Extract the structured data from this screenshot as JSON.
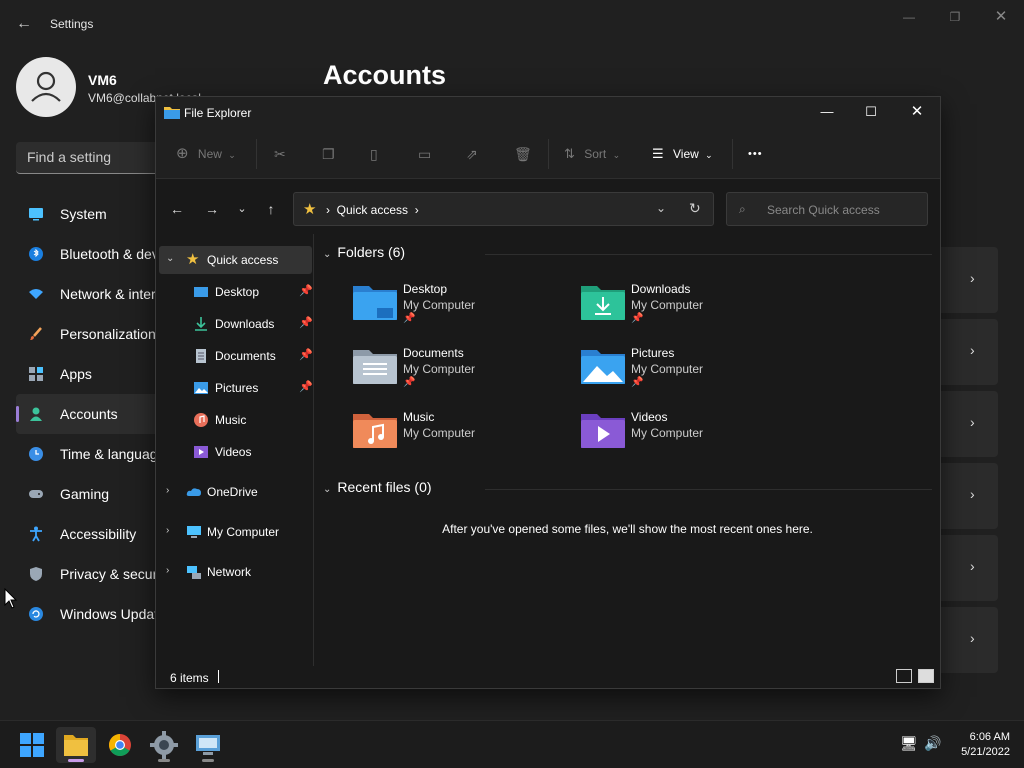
{
  "settings": {
    "title": "Settings",
    "user_name": "VM6",
    "user_email": "VM6@collabnet.local",
    "search_placeholder": "Find a setting",
    "heading": "Accounts",
    "nav": [
      {
        "label": "System",
        "icon": "monitor-icon"
      },
      {
        "label": "Bluetooth & devices",
        "icon": "bluetooth-icon"
      },
      {
        "label": "Network & internet",
        "icon": "wifi-icon"
      },
      {
        "label": "Personalization",
        "icon": "brush-icon"
      },
      {
        "label": "Apps",
        "icon": "apps-icon"
      },
      {
        "label": "Accounts",
        "icon": "person-icon",
        "active": true
      },
      {
        "label": "Time & language",
        "icon": "clock-icon"
      },
      {
        "label": "Gaming",
        "icon": "gamepad-icon"
      },
      {
        "label": "Accessibility",
        "icon": "accessibility-icon"
      },
      {
        "label": "Privacy & security",
        "icon": "shield-icon"
      },
      {
        "label": "Windows Update",
        "icon": "update-icon"
      }
    ]
  },
  "explorer": {
    "title": "File Explorer",
    "toolbar": {
      "new": "New",
      "sort": "Sort",
      "view": "View",
      "more": "•••"
    },
    "address": "Quick access",
    "search_placeholder": "Search Quick access",
    "tree": [
      {
        "label": "Quick access",
        "icon": "star-icon",
        "expanded": true,
        "selected": true
      },
      {
        "label": "Desktop",
        "icon": "desktop-icon",
        "pinned": true
      },
      {
        "label": "Downloads",
        "icon": "download-icon",
        "pinned": true
      },
      {
        "label": "Documents",
        "icon": "documents-icon",
        "pinned": true
      },
      {
        "label": "Pictures",
        "icon": "pictures-icon",
        "pinned": true
      },
      {
        "label": "Music",
        "icon": "music-icon"
      },
      {
        "label": "Videos",
        "icon": "videos-icon"
      },
      {
        "label": "OneDrive",
        "icon": "cloud-icon"
      },
      {
        "label": "My Computer",
        "icon": "computer-icon"
      },
      {
        "label": "Network",
        "icon": "network-icon"
      }
    ],
    "folders_heading": "Folders (6)",
    "folders": [
      {
        "name": "Desktop",
        "location": "My Computer",
        "pinned": true,
        "icon": "desktop-folder-icon"
      },
      {
        "name": "Downloads",
        "location": "My Computer",
        "pinned": true,
        "icon": "downloads-folder-icon"
      },
      {
        "name": "Documents",
        "location": "My Computer",
        "pinned": true,
        "icon": "documents-folder-icon"
      },
      {
        "name": "Pictures",
        "location": "My Computer",
        "pinned": true,
        "icon": "pictures-folder-icon"
      },
      {
        "name": "Music",
        "location": "My Computer",
        "pinned": false,
        "icon": "music-folder-icon"
      },
      {
        "name": "Videos",
        "location": "My Computer",
        "pinned": false,
        "icon": "videos-folder-icon"
      }
    ],
    "recent_heading": "Recent files (0)",
    "recent_empty": "After you've opened some files, we'll show the most recent ones here.",
    "status_count": "6 items"
  },
  "taskbar": {
    "time": "6:06 AM",
    "date": "5/21/2022"
  },
  "colors": {
    "accent": "#c89be8",
    "folder_blue": "#3a9be8",
    "folder_yellow": "#f0c040"
  }
}
